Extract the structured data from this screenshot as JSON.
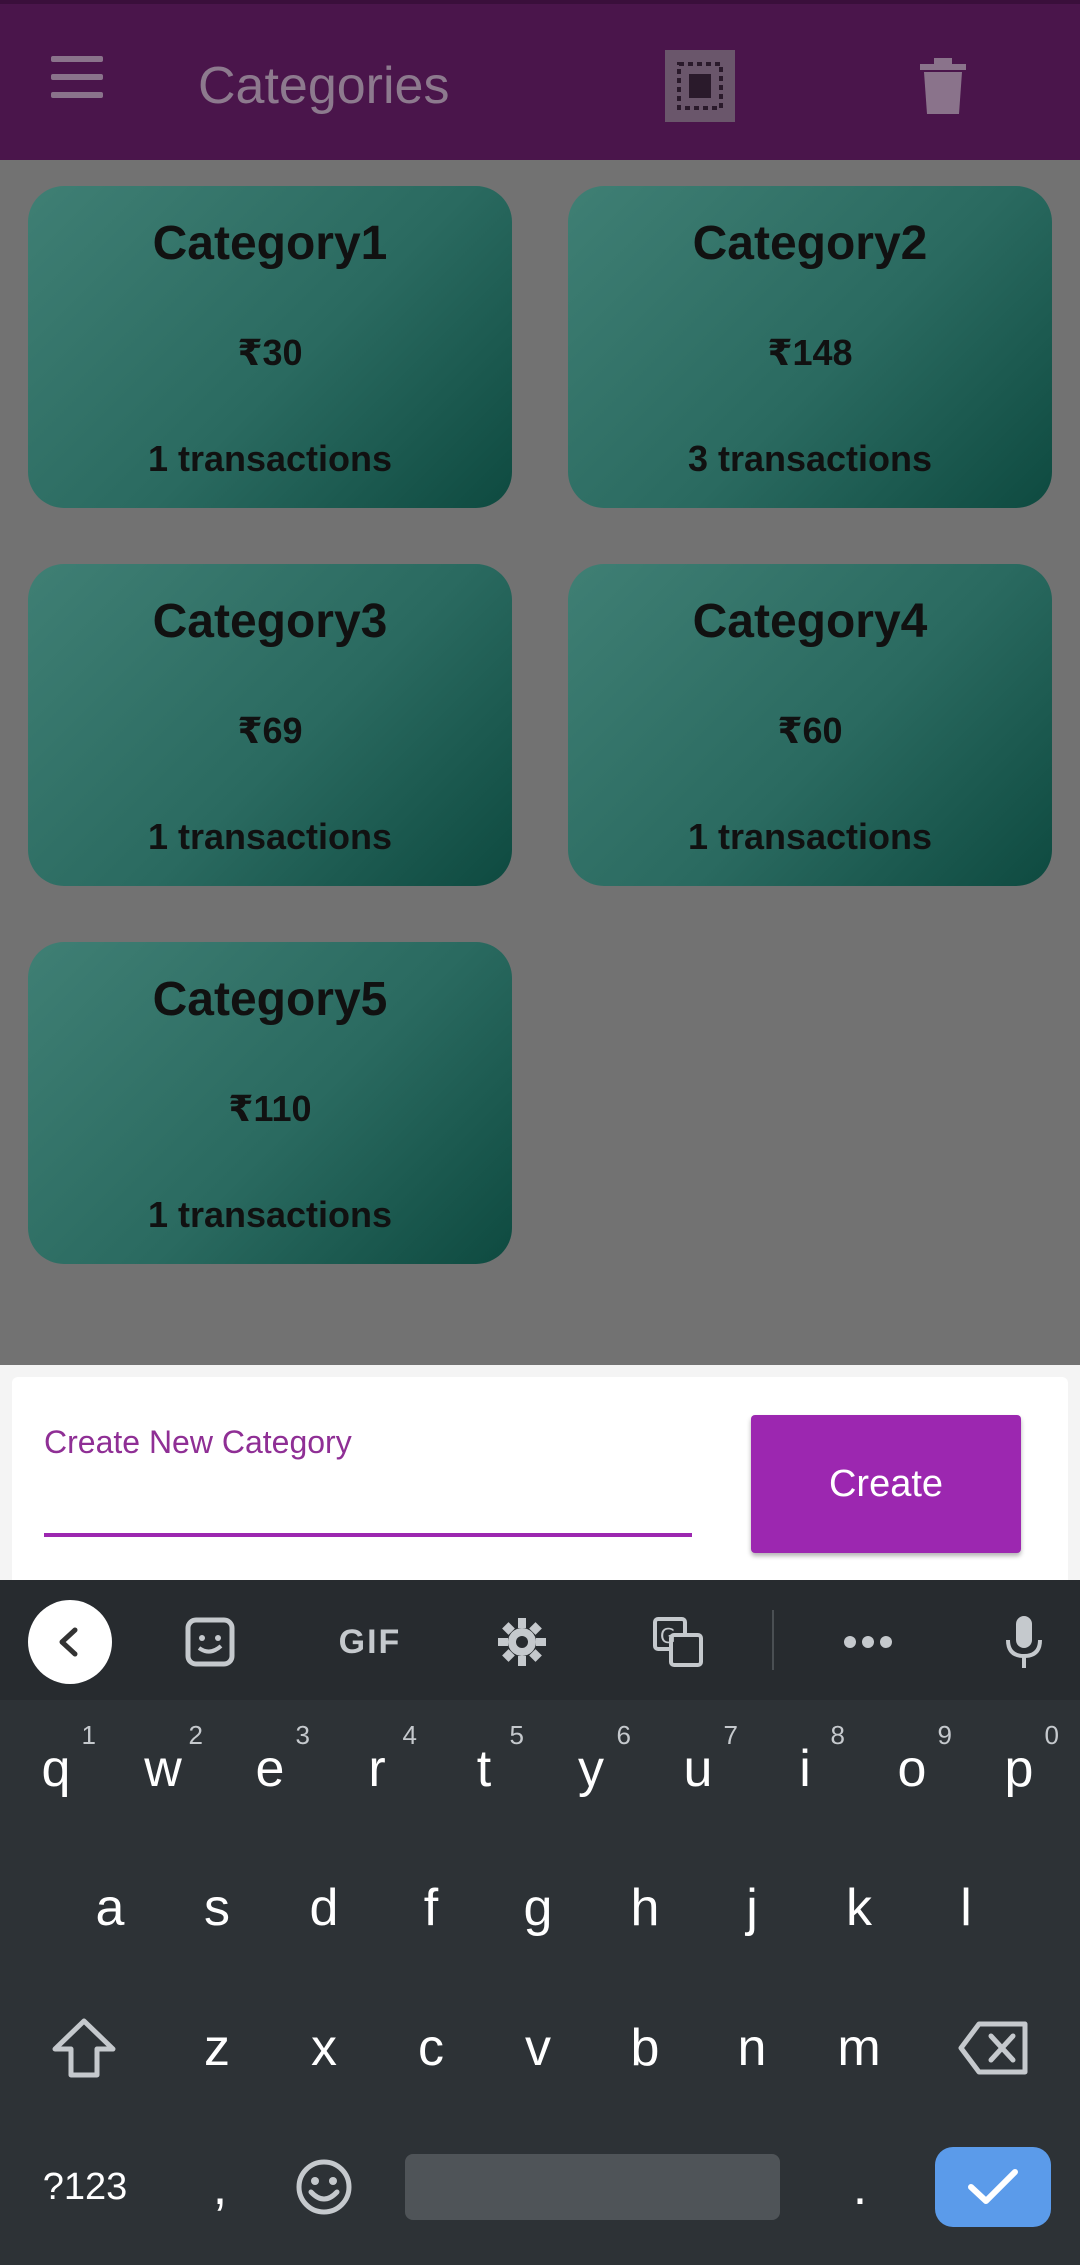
{
  "appbar": {
    "title": "Categories",
    "background": "#4a154b",
    "icons": [
      "menu-icon",
      "select-all-icon",
      "delete-icon"
    ]
  },
  "categories": [
    {
      "name": "Category1",
      "amount": "₹30",
      "count": "1 transactions"
    },
    {
      "name": "Category2",
      "amount": "₹148",
      "count": "3 transactions"
    },
    {
      "name": "Category3",
      "amount": "₹69",
      "count": "1 transactions"
    },
    {
      "name": "Category4",
      "amount": "₹60",
      "count": "1 transactions"
    },
    {
      "name": "Category5",
      "amount": "₹110",
      "count": "1 transactions"
    }
  ],
  "create_sheet": {
    "label": "Create New Category",
    "value": "",
    "button": "Create",
    "accent": "#9c27b0"
  },
  "keyboard": {
    "toolbar": {
      "gif": "GIF"
    },
    "row1": [
      {
        "k": "q",
        "h": "1"
      },
      {
        "k": "w",
        "h": "2"
      },
      {
        "k": "e",
        "h": "3"
      },
      {
        "k": "r",
        "h": "4"
      },
      {
        "k": "t",
        "h": "5"
      },
      {
        "k": "y",
        "h": "6"
      },
      {
        "k": "u",
        "h": "7"
      },
      {
        "k": "i",
        "h": "8"
      },
      {
        "k": "o",
        "h": "9"
      },
      {
        "k": "p",
        "h": "0"
      }
    ],
    "row2": [
      "a",
      "s",
      "d",
      "f",
      "g",
      "h",
      "j",
      "k",
      "l"
    ],
    "row3": [
      "z",
      "x",
      "c",
      "v",
      "b",
      "n",
      "m"
    ],
    "symbols": "?123",
    "comma": ",",
    "period": ".",
    "enter_color": "#5b9bea"
  }
}
